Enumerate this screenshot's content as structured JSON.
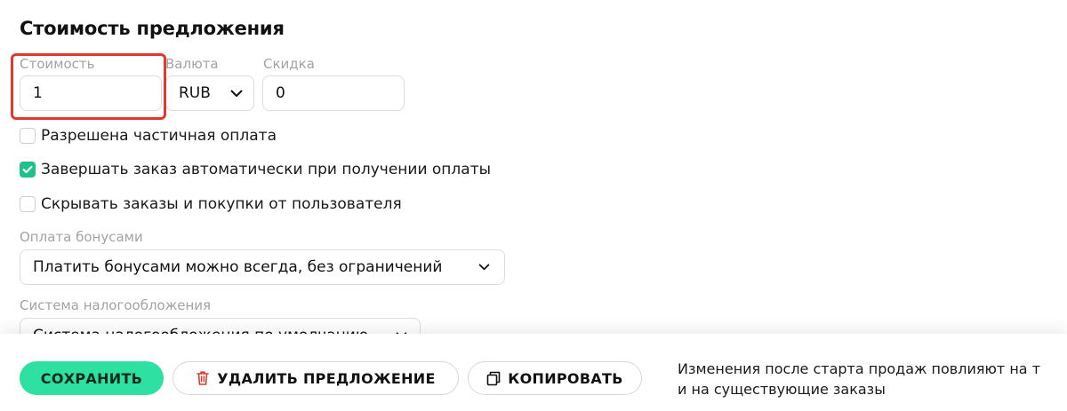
{
  "section": {
    "title": "Стоимость предложения"
  },
  "price": {
    "cost_label": "Стоимость",
    "cost_value": "1",
    "currency_label": "Валюта",
    "currency_value": "RUB",
    "discount_label": "Скидка",
    "discount_value": "0"
  },
  "options": [
    {
      "label": "Разрешена частичная оплата",
      "checked": false
    },
    {
      "label": "Завершать заказ автоматически при получении оплаты",
      "checked": true
    },
    {
      "label": "Скрывать заказы и покупки от пользователя",
      "checked": false
    }
  ],
  "bonus": {
    "label": "Оплата бонусами",
    "value": "Платить бонусами можно всегда, без ограничений"
  },
  "tax": {
    "label": "Система налогообложения",
    "value": "Система налогообложения по умолчанию"
  },
  "actions": {
    "save_label": "СОХРАНИТЬ",
    "delete_label": "УДАЛИТЬ ПРЕДЛОЖЕНИЕ",
    "copy_label": "КОПИРОВАТЬ",
    "note_line1": "Изменения после старта продаж повлияют на т",
    "note_line2": "и на существующие заказы"
  },
  "colors": {
    "accent": "#2ee0a2",
    "checkbox_checked": "#21c08b",
    "highlight": "#e0392f",
    "delete_icon": "#e0392f"
  }
}
